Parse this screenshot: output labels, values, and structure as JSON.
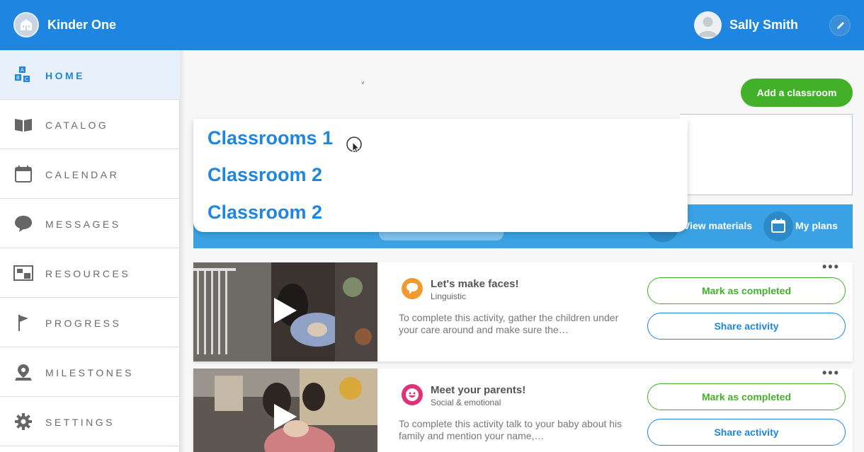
{
  "app": {
    "title": "Kinder One"
  },
  "user": {
    "name": "Sally Smith"
  },
  "nav": [
    {
      "label": "HOME",
      "icon": "abc-blocks-icon",
      "active": true
    },
    {
      "label": "CATALOG",
      "icon": "book-icon"
    },
    {
      "label": "CALENDAR",
      "icon": "calendar-icon"
    },
    {
      "label": "MESSAGES",
      "icon": "chat-bubble-icon"
    },
    {
      "label": "RESOURCES",
      "icon": "resources-icon"
    },
    {
      "label": "PROGRESS",
      "icon": "flag-icon"
    },
    {
      "label": "MILESTONES",
      "icon": "map-pin-icon"
    },
    {
      "label": "SETTINGS",
      "icon": "gear-icon"
    }
  ],
  "main": {
    "add_classroom_label": "Add a classroom",
    "dropdown": [
      "Classrooms 1",
      "Classroom 2",
      "Classroom 2"
    ],
    "toolbar": {
      "view_materials": "View materials",
      "my_plans": "My plans"
    }
  },
  "activities": [
    {
      "title": "Let's make faces!",
      "category": "Linguistic",
      "description": "To complete this activity, gather the children under your care around and make sure the…",
      "complete_label": "Mark as completed",
      "share_label": "Share activity",
      "icon": "speech-bubble-icon",
      "icon_color": "#f39a2e"
    },
    {
      "title": "Meet your parents!",
      "category": "Social & emotional",
      "description": "To complete this activity talk to your baby about his family and mention your name,…",
      "complete_label": "Mark as completed",
      "share_label": "Share activity",
      "icon": "smiley-face-icon",
      "icon_color": "#e0327a"
    }
  ],
  "colors": {
    "primary": "#1e86e0",
    "accent": "#43b02a",
    "toolbar": "#3aa2e4"
  }
}
